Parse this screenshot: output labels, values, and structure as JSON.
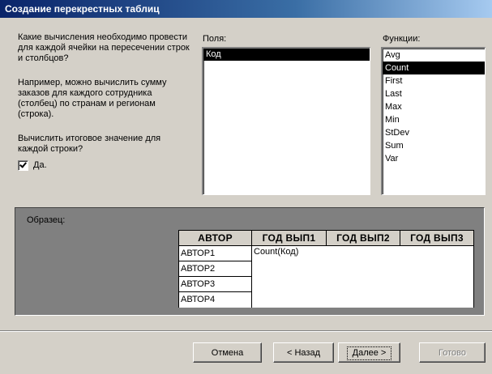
{
  "window": {
    "title": "Создание перекрестных таблиц"
  },
  "instructions": {
    "question": "Какие вычисления необходимо провести для каждой ячейки на пересечении строк и столбцов?",
    "example": "Например, можно вычислить сумму заказов для каждого сотрудника (столбец) по странам и регионам (строка).",
    "totals_question": "Вычислить итоговое значение для каждой строки?",
    "totals_checkbox": {
      "label": "Да.",
      "checked": true
    }
  },
  "fields": {
    "label": "Поля:",
    "items": [
      {
        "label": "Код",
        "selected": true
      }
    ]
  },
  "functions": {
    "label": "Функции:",
    "items": [
      {
        "label": "Avg",
        "selected": false
      },
      {
        "label": "Count",
        "selected": true
      },
      {
        "label": "First",
        "selected": false
      },
      {
        "label": "Last",
        "selected": false
      },
      {
        "label": "Max",
        "selected": false
      },
      {
        "label": "Min",
        "selected": false
      },
      {
        "label": "StDev",
        "selected": false
      },
      {
        "label": "Sum",
        "selected": false
      },
      {
        "label": "Var",
        "selected": false
      }
    ]
  },
  "sample": {
    "label": "Образец:",
    "headers": [
      "АВТОР",
      "ГОД ВЫП1",
      "ГОД ВЫП2",
      "ГОД ВЫП3"
    ],
    "rows": [
      "АВТОР1",
      "АВТОР2",
      "АВТОР3",
      "АВТОР4"
    ],
    "value": "Count(Код)"
  },
  "buttons": {
    "cancel": "Отмена",
    "back": "< Назад",
    "next": "Далее >",
    "finish": "Готово"
  }
}
